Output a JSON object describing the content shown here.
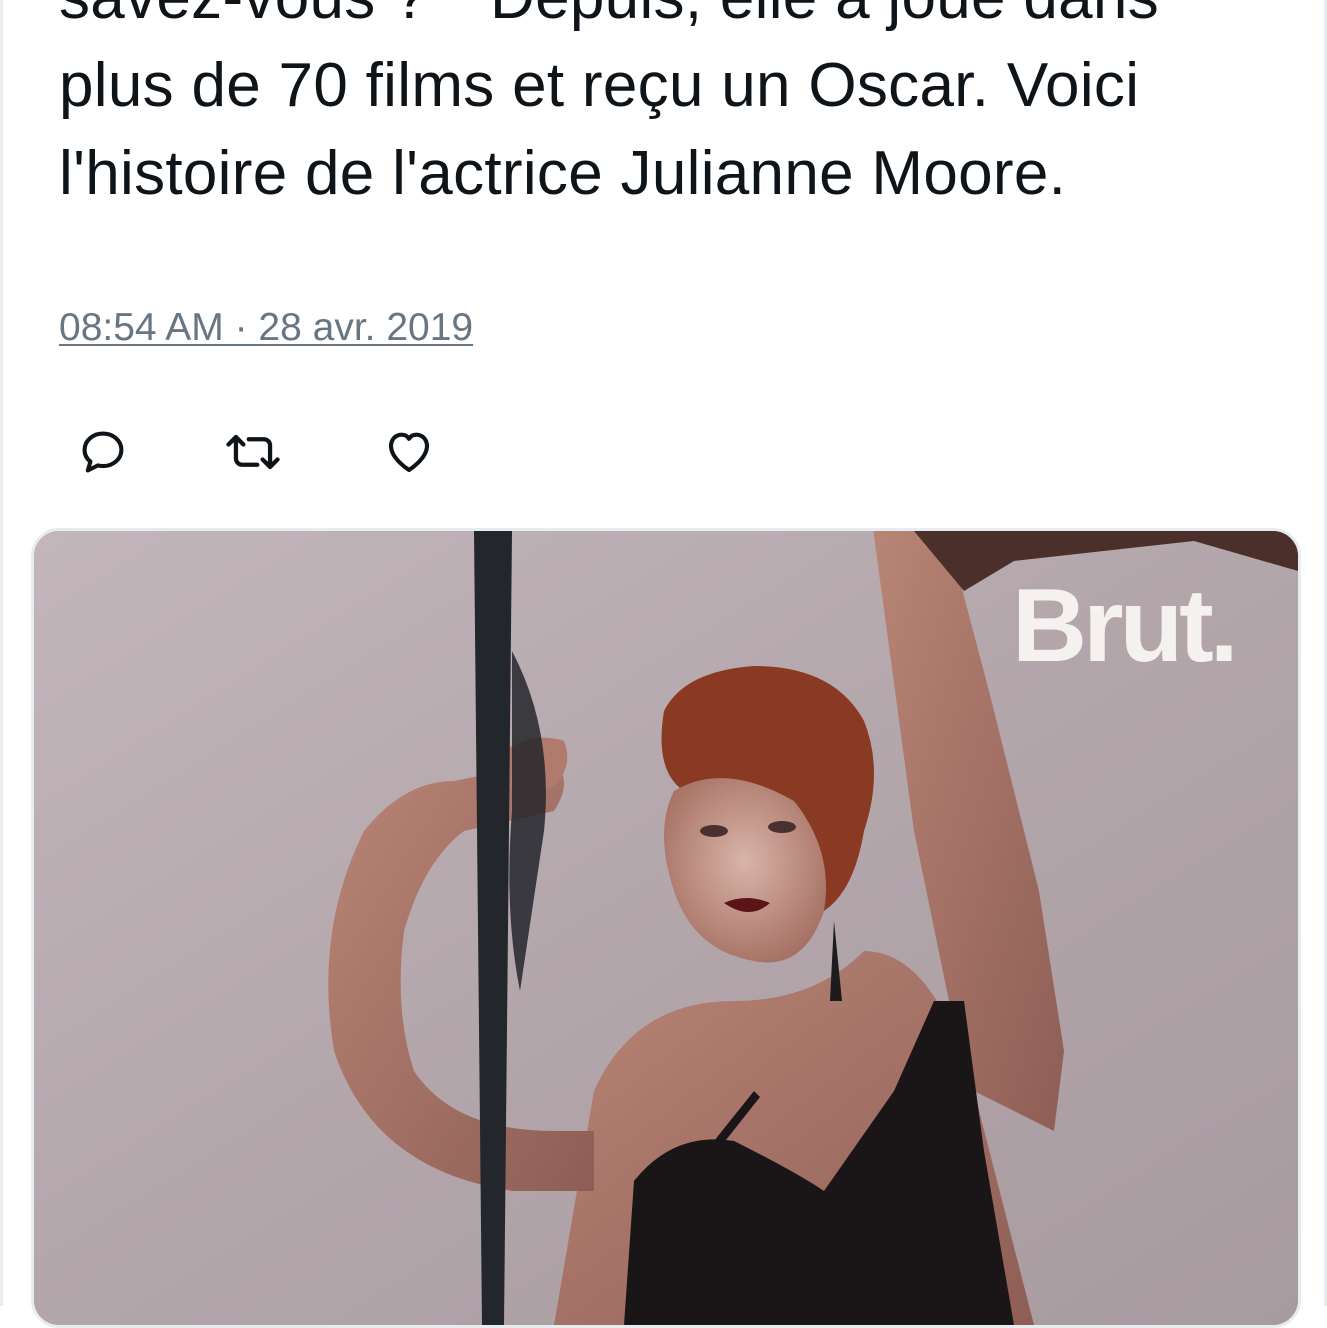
{
  "tweet": {
    "text_lines": [
      "savez-vous ?\"\" Depuis, elle a joué dans",
      "plus de 70 films et reçu un Oscar. Voici",
      "l'histoire de l'actrice Julianne Moore."
    ],
    "timestamp": "08:54 AM · 28 avr. 2019"
  },
  "actions": {
    "reply_icon": "reply-icon",
    "retweet_icon": "retweet-icon",
    "like_icon": "heart-icon"
  },
  "media": {
    "watermark": "Brut.",
    "colors": {
      "background": "#b6a9ae",
      "hair": "#8a3a22",
      "skin": "#c79a8c",
      "dress": "#1a1617",
      "pole": "#23262b"
    }
  },
  "colors": {
    "text": "#0f1419",
    "secondary": "#687684",
    "border": "#e6ecf0"
  }
}
